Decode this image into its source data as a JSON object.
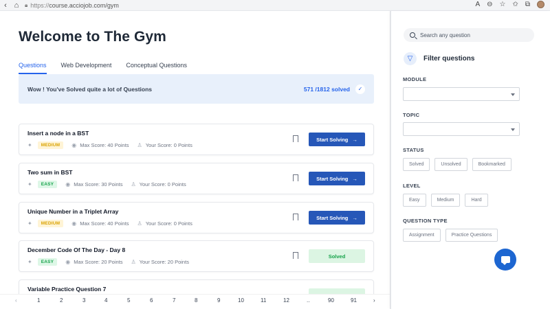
{
  "browser": {
    "url": "https://course.acciojob.com/gym",
    "url_prefix": "https://",
    "url_rest": "course.acciojob.com/gym",
    "icons": [
      "back-icon",
      "home-icon",
      "lock-icon",
      "read-aloud-icon",
      "zoom-icon",
      "favorite-icon",
      "favorites-icon",
      "collections-icon"
    ]
  },
  "page": {
    "title": "Welcome to The Gym",
    "tabs": [
      {
        "label": "Questions",
        "active": true
      },
      {
        "label": "Web Development",
        "active": false
      },
      {
        "label": "Conceptual Questions",
        "active": false
      }
    ],
    "banner": {
      "message": "Wow ! You've Solved quite a lot of Questions",
      "solved_count": "571 /1812 solved"
    },
    "questions": [
      {
        "name": "Insert a node in a BST",
        "level": "MEDIUM",
        "max_score": "Max Score: 40 Points",
        "your_score": "Your Score: 0 Points",
        "action": "Start Solving"
      },
      {
        "name": "Two sum in BST",
        "level": "EASY",
        "max_score": "Max Score: 30 Points",
        "your_score": "Your Score: 0 Points",
        "action": "Start Solving"
      },
      {
        "name": "Unique Number in a Triplet Array",
        "level": "MEDIUM",
        "max_score": "Max Score: 40 Points",
        "your_score": "Your Score: 0 Points",
        "action": "Start Solving"
      },
      {
        "name": "December Code Of The Day - Day 8",
        "level": "EASY",
        "max_score": "Max Score: 20 Points",
        "your_score": "Your Score: 20 Points",
        "action": "Solved"
      },
      {
        "name": "Variable Practice Question 7",
        "level": "",
        "max_score": "",
        "your_score": "",
        "action": ""
      }
    ],
    "pagination": {
      "prev": "‹",
      "pages": [
        "1",
        "2",
        "3",
        "4",
        "5",
        "6",
        "7",
        "8",
        "9",
        "10",
        "11",
        "12",
        "..",
        "90",
        "91"
      ],
      "next": "›"
    }
  },
  "sidebar": {
    "search_placeholder": "Search any question",
    "filter_title": "Filter questions",
    "module_label": "MODULE",
    "topic_label": "TOPIC",
    "status_label": "STATUS",
    "status_options": [
      "Solved",
      "Unsolved",
      "Bookmarked"
    ],
    "level_label": "LEVEL",
    "level_options": [
      "Easy",
      "Medium",
      "Hard"
    ],
    "type_label": "QUESTION TYPE",
    "type_options": [
      "Assignment",
      "Practice Questions"
    ]
  },
  "colors": {
    "primary": "#2657b8",
    "accent_blue": "#2563eb",
    "medium_badge": "#d9a200",
    "easy_badge": "#16a34a",
    "banner_bg": "#e8f0fb"
  }
}
